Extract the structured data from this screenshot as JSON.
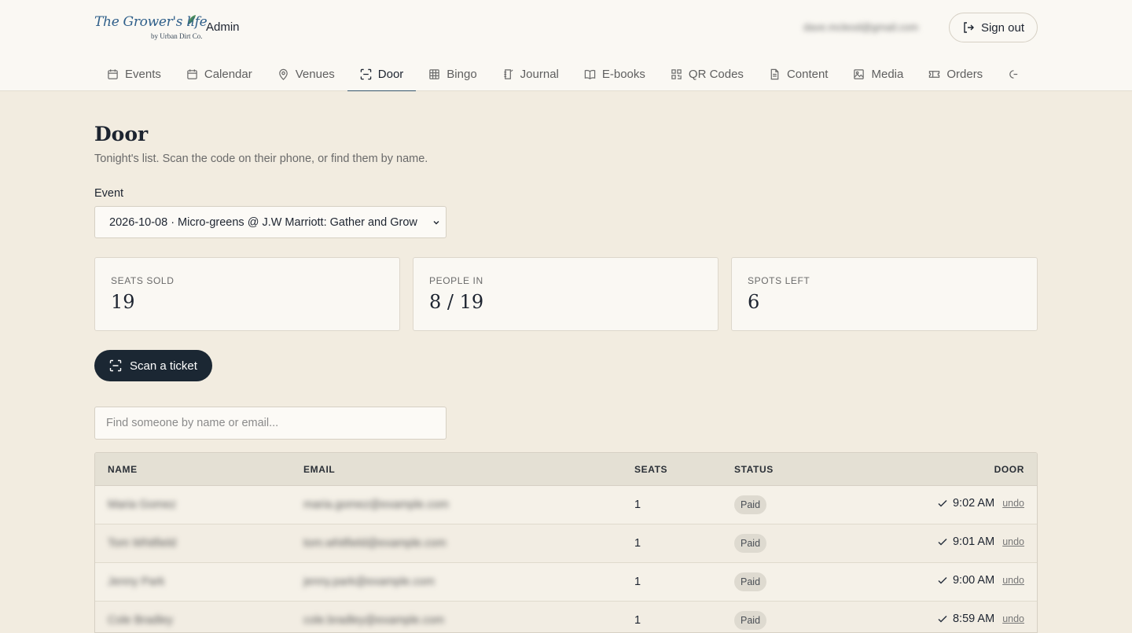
{
  "header": {
    "logo_text": "The Grower's life",
    "logo_sub": "by Urban Dirt Co.",
    "admin_label": "Admin",
    "user_email": "dave.mcleod@gmail.com",
    "signout_label": "Sign out"
  },
  "nav": {
    "tabs": [
      {
        "label": "Events",
        "icon": "calendar-icon"
      },
      {
        "label": "Calendar",
        "icon": "calendar-icon"
      },
      {
        "label": "Venues",
        "icon": "map-pin-icon"
      },
      {
        "label": "Door",
        "icon": "scan-icon",
        "active": true
      },
      {
        "label": "Bingo",
        "icon": "grid-icon"
      },
      {
        "label": "Journal",
        "icon": "notebook-icon"
      },
      {
        "label": "E-books",
        "icon": "book-icon"
      },
      {
        "label": "QR Codes",
        "icon": "qr-icon"
      },
      {
        "label": "Content",
        "icon": "file-icon"
      },
      {
        "label": "Media",
        "icon": "image-icon"
      },
      {
        "label": "Orders",
        "icon": "ticket-icon"
      }
    ]
  },
  "page": {
    "title": "Door",
    "subtitle": "Tonight's list. Scan the code on their phone, or find them by name.",
    "event_label": "Event",
    "event_selected": "2026-10-08 · Micro-greens @ J.W Marriott: Gather and Grow"
  },
  "stats": {
    "seats_sold_label": "SEATS SOLD",
    "seats_sold_value": "19",
    "people_in_label": "PEOPLE IN",
    "people_in_value": "8 / 19",
    "spots_left_label": "SPOTS LEFT",
    "spots_left_value": "6"
  },
  "actions": {
    "scan_label": "Scan a ticket",
    "search_placeholder": "Find someone by name or email..."
  },
  "table": {
    "headers": {
      "name": "NAME",
      "email": "EMAIL",
      "seats": "SEATS",
      "status": "STATUS",
      "door": "DOOR"
    },
    "rows": [
      {
        "name": "Maria Gomez",
        "email": "maria.gomez@example.com",
        "seats": "1",
        "status": "Paid",
        "time": "9:02 AM",
        "undo": "undo"
      },
      {
        "name": "Tom Whitfield",
        "email": "tom.whitfield@example.com",
        "seats": "1",
        "status": "Paid",
        "time": "9:01 AM",
        "undo": "undo"
      },
      {
        "name": "Jenny Park",
        "email": "jenny.park@example.com",
        "seats": "1",
        "status": "Paid",
        "time": "9:00 AM",
        "undo": "undo"
      },
      {
        "name": "Cole Bradley",
        "email": "cole.bradley@example.com",
        "seats": "1",
        "status": "Paid",
        "time": "8:59 AM",
        "undo": "undo"
      }
    ]
  },
  "colors": {
    "background": "#f2ece0",
    "topbar": "#faf8f3",
    "accent": "#36556b",
    "primary_button": "#1b2733"
  }
}
